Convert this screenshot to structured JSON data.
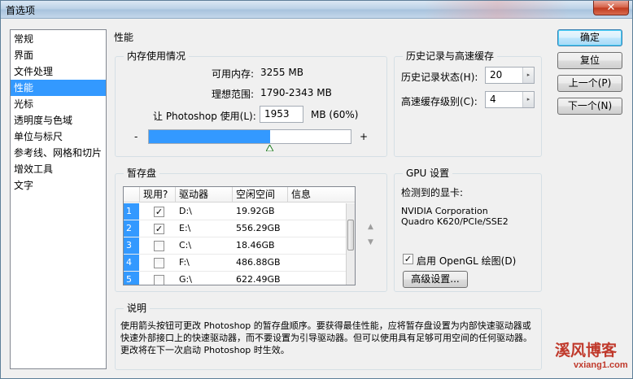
{
  "window": {
    "title": "首选项",
    "close_label": "✕"
  },
  "nav": {
    "items": [
      "常规",
      "界面",
      "文件处理",
      "性能",
      "光标",
      "透明度与色域",
      "单位与标尺",
      "参考线、网格和切片",
      "增效工具",
      "文字"
    ],
    "selected_index": 3
  },
  "page_title": "性能",
  "memory": {
    "label": "内存使用情况",
    "available_label": "可用内存:",
    "available_value": "3255 MB",
    "range_label": "理想范围:",
    "range_value": "1790-2343 MB",
    "use_label": "让 Photoshop 使用(L):",
    "use_value": "1953",
    "use_unit": "MB (60%)",
    "minus": "-",
    "plus": "+",
    "slider_fraction": 0.6
  },
  "history": {
    "label": "历史记录与高速缓存",
    "states_label": "历史记录状态(H):",
    "states_value": "20",
    "cache_label": "高速缓存级别(C):",
    "cache_value": "4"
  },
  "buttons": {
    "ok": "确定",
    "reset": "复位",
    "prev": "上一个(P)",
    "next": "下一个(N)"
  },
  "scratch": {
    "label": "暂存盘",
    "headers": [
      "现用?",
      "驱动器",
      "空闲空间",
      "信息"
    ],
    "rows": [
      {
        "num": "1",
        "active": true,
        "drive": "D:\\",
        "free": "19.92GB"
      },
      {
        "num": "2",
        "active": true,
        "drive": "E:\\",
        "free": "556.29GB"
      },
      {
        "num": "3",
        "active": false,
        "drive": "C:\\",
        "free": "18.46GB"
      },
      {
        "num": "4",
        "active": false,
        "drive": "F:\\",
        "free": "486.88GB"
      },
      {
        "num": "5",
        "active": false,
        "drive": "G:\\",
        "free": "622.49GB"
      }
    ]
  },
  "gpu": {
    "label": "GPU 设置",
    "detected_label": "检测到的显卡:",
    "card_line1": "NVIDIA Corporation",
    "card_line2": "Quadro K620/PCIe/SSE2",
    "opengl_label": "启用 OpenGL 绘图(D)",
    "opengl_checked": true,
    "advanced_button": "高级设置..."
  },
  "description": {
    "label": "说明",
    "text": "使用箭头按钮可更改 Photoshop 的暂存盘顺序。要获得最佳性能，应将暂存盘设置为内部快速驱动器或快速外部接口上的快速驱动器，而不要设置为引导驱动器。但可以使用具有足够可用空间的任何驱动器。更改将在下一次启动 Photoshop 时生效。"
  },
  "watermark": {
    "line1": "溪风博客",
    "line2": "vxiang1.com"
  },
  "icons": {
    "check": "checkmark-icon",
    "spin": "spin-arrow-icon",
    "up": "move-up-icon",
    "down": "move-down-icon"
  },
  "colors": {
    "selection": "#3399ff",
    "window_bg": "#f0f0f0",
    "watermark": "#c0392b"
  }
}
